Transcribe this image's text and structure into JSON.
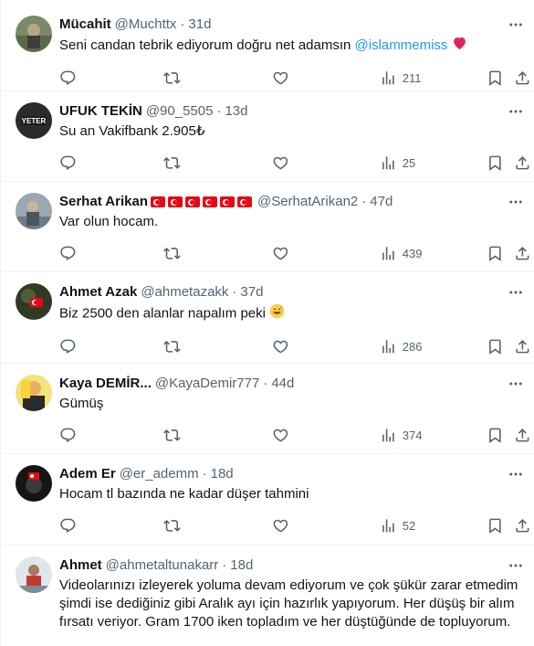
{
  "tweets": [
    {
      "name": "Mücahit",
      "handle": "@Muchttx",
      "time": "31d",
      "text_before": "Seni candan tebrik ediyorum doğru net adamsın ",
      "mention": "@islammemiss",
      "text_after": "",
      "emoji": "red-heart",
      "views": "211",
      "avatar_color": "#6b7d5a"
    },
    {
      "name": "UFUK TEKİN",
      "handle": "@90_5505",
      "time": "13d",
      "text": "Su an Vakifbank 2.905₺",
      "avatar_text": "YETER",
      "views": "25",
      "avatar_color": "#2f2f2f"
    },
    {
      "name": "Serhat Arikan",
      "handle": "@SerhatArikan2",
      "time": "47d",
      "text": "Var olun hocam.",
      "flags": 6,
      "views": "439",
      "avatar_color": "#8a9aa6"
    },
    {
      "name": "Ahmet Azak",
      "handle": "@ahmetazakk",
      "time": "37d",
      "text": "Biz 2500 den alanlar napalım peki",
      "emoji": "sweat-smile",
      "views": "286",
      "avatar_color": "#3a4a2c"
    },
    {
      "name": "Kaya DEMİR...",
      "handle": "@KayaDemir777",
      "time": "44d",
      "text": "Gümüş",
      "views": "374",
      "avatar_color": "#e2c64b"
    },
    {
      "name": "Adem Er",
      "handle": "@er_ademm",
      "time": "18d",
      "text": "Hocam tl bazında ne kadar düşer tahmini",
      "views": "52",
      "avatar_color": "#1e1e1e"
    },
    {
      "name": "Ahmet",
      "handle": "@ahmetaltunakarr",
      "time": "18d",
      "text": "Videolarınızı izleyerek yoluma devam ediyorum ve çok şükür zarar etmedim şimdi ise dediğiniz gibi Aralık ayı için hazırlık yapıyorum. Her düşüş bir alım fırsatı veriyor. Gram 1700 iken topladım ve her düştüğünde de topluyorum.",
      "avatar_color": "#c9d3dc"
    }
  ],
  "ui": {
    "separator": "·",
    "colors": {
      "text": "#0f1419",
      "secondary": "#536471",
      "mention": "#1d9bf0",
      "divider": "#eff3f4"
    }
  }
}
